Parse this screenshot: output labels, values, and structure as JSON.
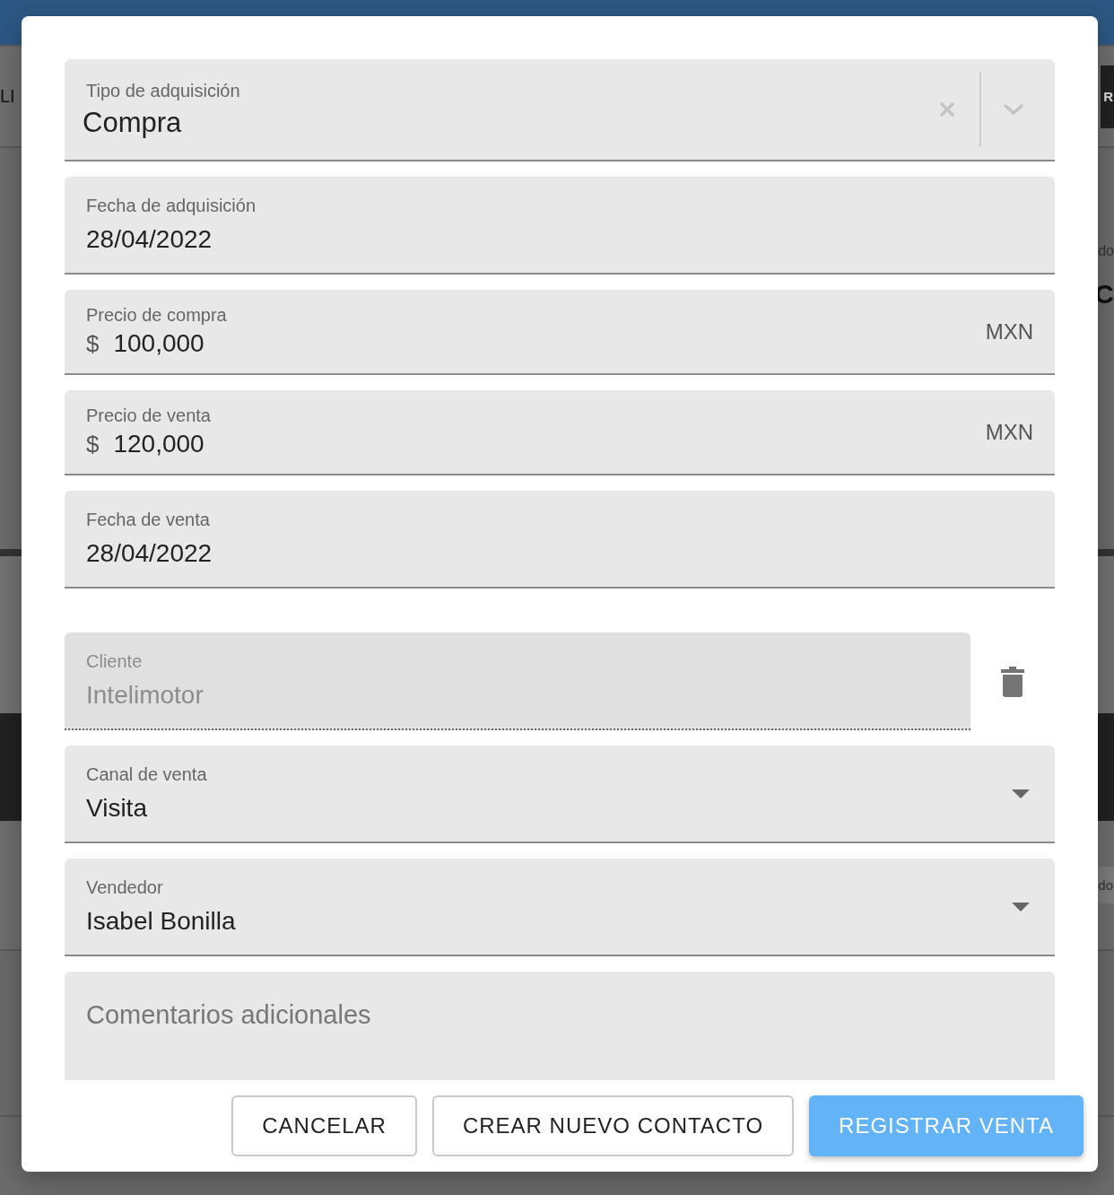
{
  "background": {
    "left_texts": [
      "LI"
    ],
    "right_texts": [
      {
        "text": "R",
        "kind": "tab"
      },
      {
        "text": "do",
        "kind": "caption"
      },
      {
        "text": "C",
        "kind": "heading"
      },
      {
        "text": "do",
        "kind": "chip"
      }
    ]
  },
  "dialog": {
    "fields": [
      {
        "kind": "autocomplete",
        "label": "Tipo de adquisición",
        "value": "Compra"
      },
      {
        "kind": "text",
        "label": "Fecha de adquisición",
        "value": "28/04/2022"
      },
      {
        "kind": "currency",
        "label": "Precio de compra",
        "prefix": "$",
        "value": "100,000",
        "suffix": "MXN"
      },
      {
        "kind": "currency",
        "label": "Precio de venta",
        "prefix": "$",
        "value": "120,000",
        "suffix": "MXN"
      },
      {
        "kind": "text",
        "label": "Fecha de venta",
        "value": "28/04/2022"
      },
      {
        "kind": "contact",
        "label": "Cliente",
        "value": "Intelimotor",
        "disabled": true
      },
      {
        "kind": "select",
        "label": "Canal de venta",
        "value": "Visita"
      },
      {
        "kind": "select",
        "label": "Vendedor",
        "value": "Isabel Bonilla"
      },
      {
        "kind": "textarea",
        "placeholder": "Comentarios adicionales"
      }
    ],
    "buttons": [
      {
        "label": "CANCELAR",
        "kind": "outlined"
      },
      {
        "label": "CREAR NUEVO CONTACTO",
        "kind": "outlined"
      },
      {
        "label": "REGISTRAR VENTA",
        "kind": "primary"
      }
    ]
  }
}
